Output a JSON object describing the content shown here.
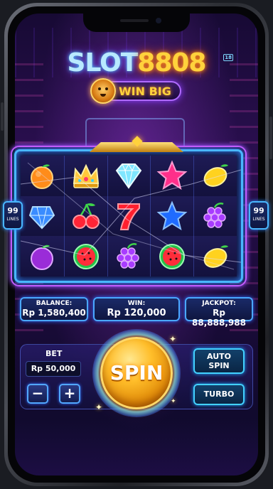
{
  "game": {
    "logo_part1": "SLOT",
    "logo_part2": "8808",
    "logo_badge": "18",
    "tagline": "WIN BIG"
  },
  "reels": {
    "symbols": [
      [
        "orange-icon",
        "crown-icon",
        "diamond-icon",
        "star-icon",
        "lemon-icon"
      ],
      [
        "gem-icon",
        "cherry-icon",
        "seven-icon",
        "star-icon",
        "grapes-icon"
      ],
      [
        "plum-icon",
        "watermelon-icon",
        "grapes-icon",
        "watermelon-icon",
        "lemon-icon"
      ]
    ]
  },
  "lines": {
    "count": "99",
    "label": "LINES"
  },
  "stats": {
    "balance_label": "BALANCE:",
    "balance_value": "Rp 1,580,400",
    "win_label": "WIN:",
    "win_value": "Rp 120,000",
    "jackpot_label": "JACKPOT:",
    "jackpot_value": "Rp 88,888,988"
  },
  "controls": {
    "bet_label": "BET",
    "bet_value": "Rp 50,000",
    "minus_label": "−",
    "plus_label": "+",
    "spin_label": "SPIN",
    "auto_spin_line1": "AUTO",
    "auto_spin_line2": "SPIN",
    "turbo_label": "TURBO"
  },
  "colors": {
    "neon_blue": "#49b7ff",
    "neon_purple": "#c15cff",
    "gold": "#ffd23c",
    "background": "#1b0b3a"
  }
}
